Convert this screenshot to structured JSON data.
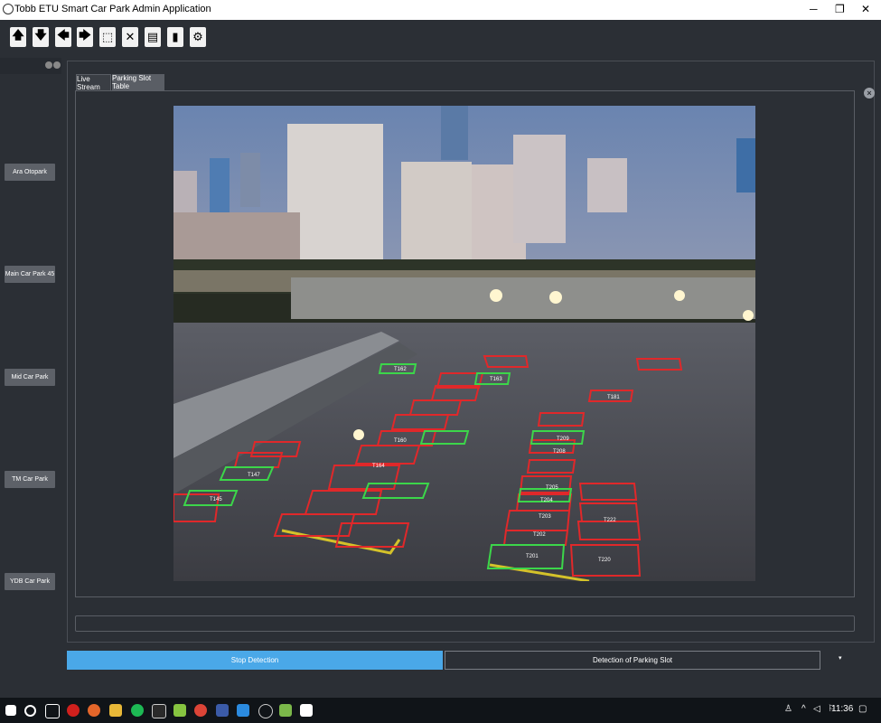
{
  "window": {
    "title": "Tobb ETU Smart Car Park Admin Application",
    "minimize": "─",
    "maximize": "❐",
    "close": "✕"
  },
  "toolbar": {
    "buttons": [
      {
        "icon": "arrow-up-icon",
        "glyph": "🡅"
      },
      {
        "icon": "arrow-down-icon",
        "glyph": "🡇"
      },
      {
        "icon": "arrow-left-icon",
        "glyph": "🡄"
      },
      {
        "icon": "arrow-right-icon",
        "glyph": "🡆"
      },
      {
        "icon": "select-region-icon",
        "glyph": "⬚"
      },
      {
        "icon": "delete-x-icon",
        "glyph": "✕"
      },
      {
        "icon": "save-icon",
        "glyph": "▤"
      },
      {
        "icon": "trash-icon",
        "glyph": "▮"
      },
      {
        "icon": "settings-gear-icon",
        "glyph": "⚙"
      }
    ]
  },
  "sidebar": {
    "car_parks": [
      "Ara Otopark",
      "Main Car Park 45",
      "Mid Car Park",
      "TM Car Park",
      "YDB Car Park"
    ]
  },
  "tabs": {
    "live": "Live Stream",
    "table": "Parking Slot Table"
  },
  "video": {
    "slot_labels": [
      "T162",
      "T163",
      "T181",
      "T209",
      "T208",
      "T205",
      "T204",
      "T203",
      "T202",
      "T201",
      "T222",
      "T220",
      "T147",
      "T145",
      "T160",
      "T164"
    ]
  },
  "controls": {
    "stop": "Stop Detection",
    "detect": "Detection of Parking Slot"
  },
  "taskbar": {
    "time": "11:36"
  },
  "colors": {
    "accent": "#4aa8e8",
    "occupied": "#e0282a",
    "free": "#3cd64a"
  }
}
